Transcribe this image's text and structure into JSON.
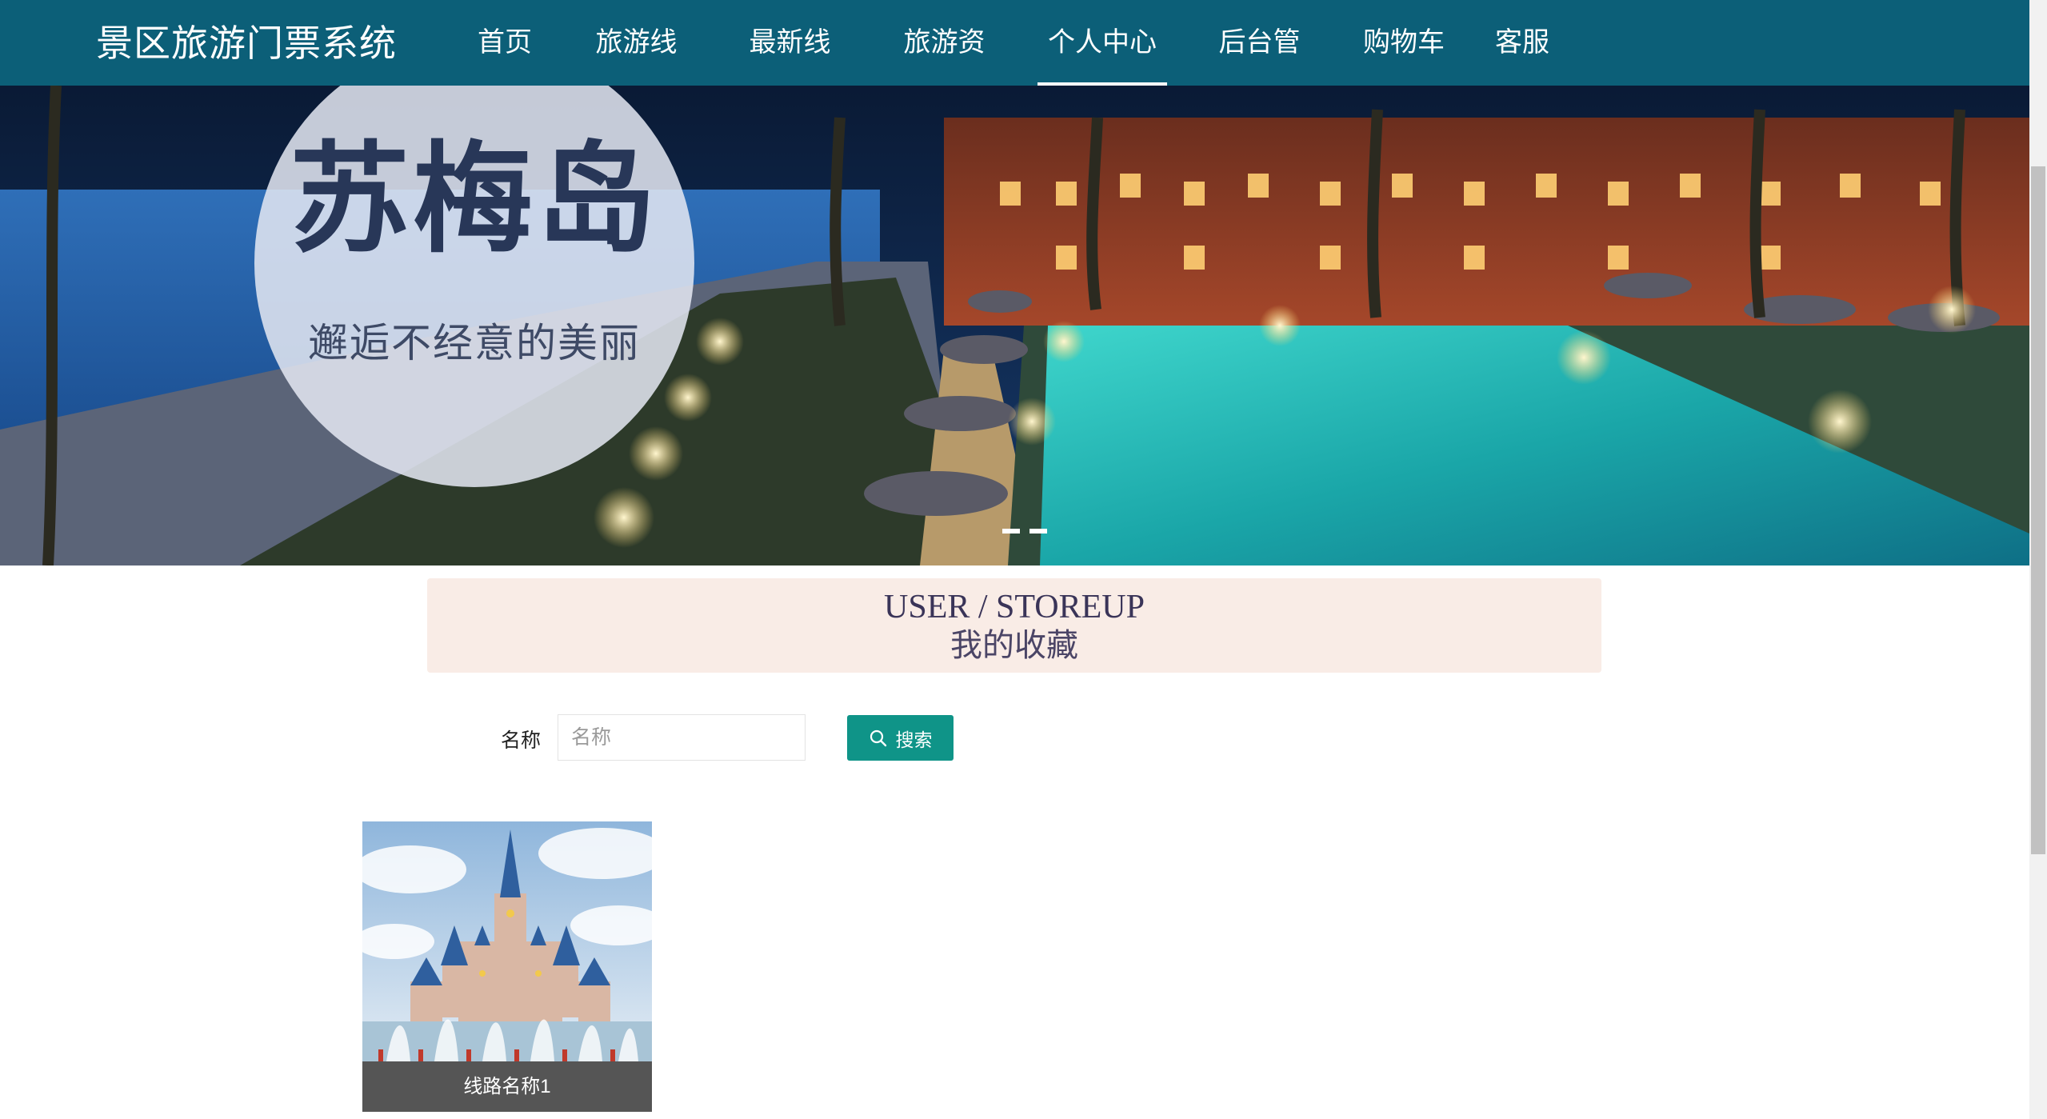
{
  "header": {
    "brand": "景区旅游门票系统",
    "nav": [
      {
        "label": "首页",
        "active": false
      },
      {
        "label": "旅游线路",
        "active": false
      },
      {
        "label": "最新线路",
        "active": false
      },
      {
        "label": "旅游资讯",
        "active": false
      },
      {
        "label": "个人中心",
        "active": true
      },
      {
        "label": "后台管理",
        "active": false
      },
      {
        "label": "购物车",
        "active": false
      },
      {
        "label": "客服",
        "active": false
      }
    ]
  },
  "banner": {
    "title": "苏梅岛",
    "subtitle": "邂逅不经意的美丽",
    "slide_count": 2,
    "active_slide": 1
  },
  "section": {
    "title_en": "USER / STOREUP",
    "title_cn": "我的收藏"
  },
  "search": {
    "label": "名称",
    "placeholder": "名称",
    "value": "",
    "button_label": "搜索",
    "button_icon": "search-icon"
  },
  "favorites": [
    {
      "name": "线路名称1"
    }
  ],
  "colors": {
    "nav_bg": "#0c5f78",
    "section_bg": "#f9ece6",
    "button_bg": "#0f9488",
    "caption_bg": "#555555"
  }
}
